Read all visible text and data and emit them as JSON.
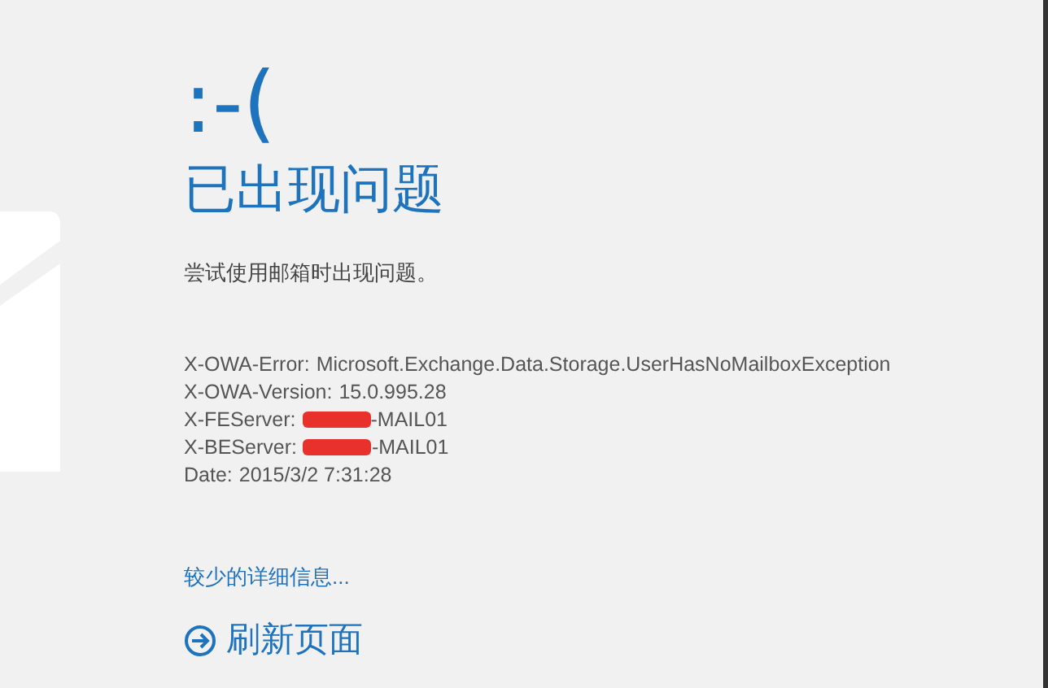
{
  "emoticon": ":-(",
  "title": "已出现问题",
  "message": "尝试使用邮箱时出现问题。",
  "details": [
    {
      "label": "X-OWA-Error:",
      "value": "Microsoft.Exchange.Data.Storage.UserHasNoMailboxException",
      "redacted": false
    },
    {
      "label": "X-OWA-Version:",
      "value": "15.0.995.28",
      "redacted": false
    },
    {
      "label": "X-FEServer:",
      "value": "-MAIL01",
      "redacted": true
    },
    {
      "label": "X-BEServer:",
      "value": "-MAIL01",
      "redacted": true
    },
    {
      "label": "Date:",
      "value": "2015/3/2 7:31:28",
      "redacted": false
    }
  ],
  "details_link": "较少的详细信息...",
  "refresh": "刷新页面"
}
